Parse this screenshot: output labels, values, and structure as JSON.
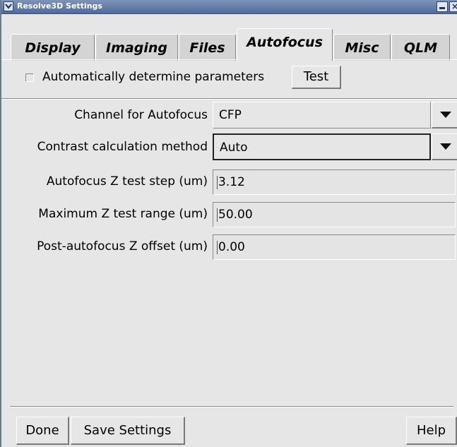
{
  "window": {
    "title": "Resolve3D Settings",
    "close_glyph": "×",
    "icons": [
      "window-menu-icon",
      "minimize-icon",
      "close-icon"
    ]
  },
  "tabs": [
    {
      "label": "Display",
      "active": false
    },
    {
      "label": "Imaging",
      "active": false
    },
    {
      "label": "Files",
      "active": false
    },
    {
      "label": "Autofocus",
      "active": true
    },
    {
      "label": "Misc",
      "active": false
    },
    {
      "label": "QLM",
      "active": false
    }
  ],
  "auto_params": {
    "checkbox_label": "Automatically determine parameters",
    "checked": false,
    "test_label": "Test"
  },
  "fields": {
    "channel": {
      "label": "Channel for Autofocus",
      "value": "CFP"
    },
    "contrast": {
      "label": "Contrast calculation method",
      "value": "Auto"
    },
    "z_step": {
      "label": "Autofocus Z test step (um)",
      "value": "3.12"
    },
    "z_range": {
      "label": "Maximum Z test range (um)",
      "value": "50.00"
    },
    "z_offset": {
      "label": "Post-autofocus Z offset (um)",
      "value": "0.00"
    }
  },
  "footer": {
    "done_label": "Done",
    "save_label": "Save Settings",
    "help_label": "Help"
  },
  "colors": {
    "titlebar": "#5a73a6",
    "panel": "#e6e6e6"
  }
}
